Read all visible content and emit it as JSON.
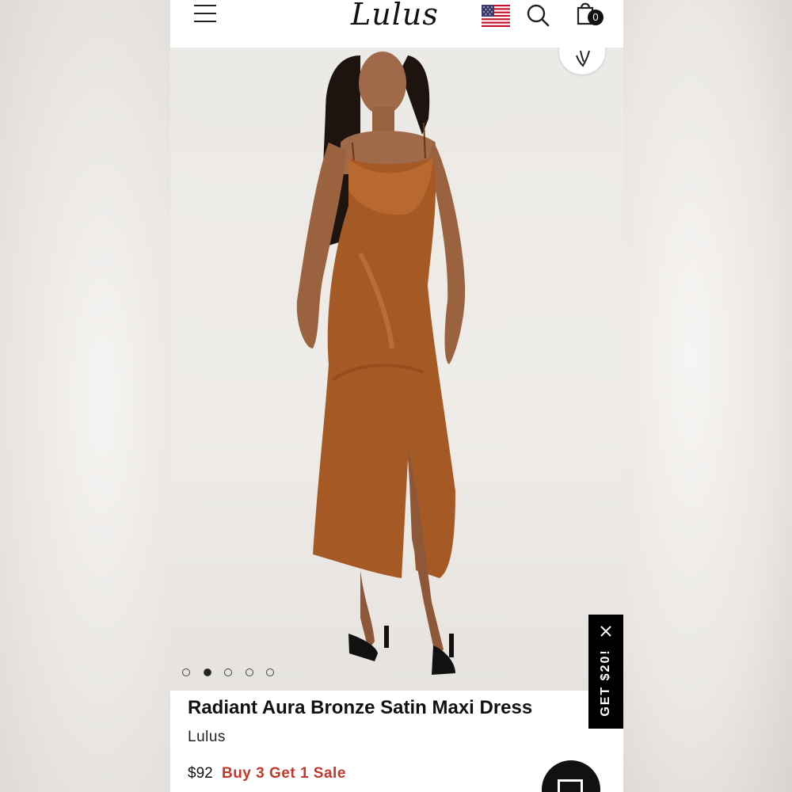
{
  "header": {
    "logo": "Lulus",
    "menu_icon": "hamburger-menu-icon",
    "flag_icon": "us-flag-icon",
    "search_icon": "search-icon",
    "bag_icon": "shopping-bag-icon",
    "bag_count": "0"
  },
  "hero": {
    "image": "model-wearing-bronze-satin-maxi-dress",
    "favorite_icon": "heart-icon",
    "carousel_total": 5,
    "carousel_active": 2
  },
  "promo": {
    "label": "GET $20!",
    "close_icon": "close-icon"
  },
  "product": {
    "title": "Radiant Aura Bronze Satin Maxi Dress",
    "brand": "Lulus",
    "price": "$92",
    "sale_text": "Buy 3 Get 1 Sale"
  },
  "colors": {
    "sale_red": "#c0392b",
    "dress_bronze": "#a55a26"
  },
  "chat_icon": "chat-icon"
}
